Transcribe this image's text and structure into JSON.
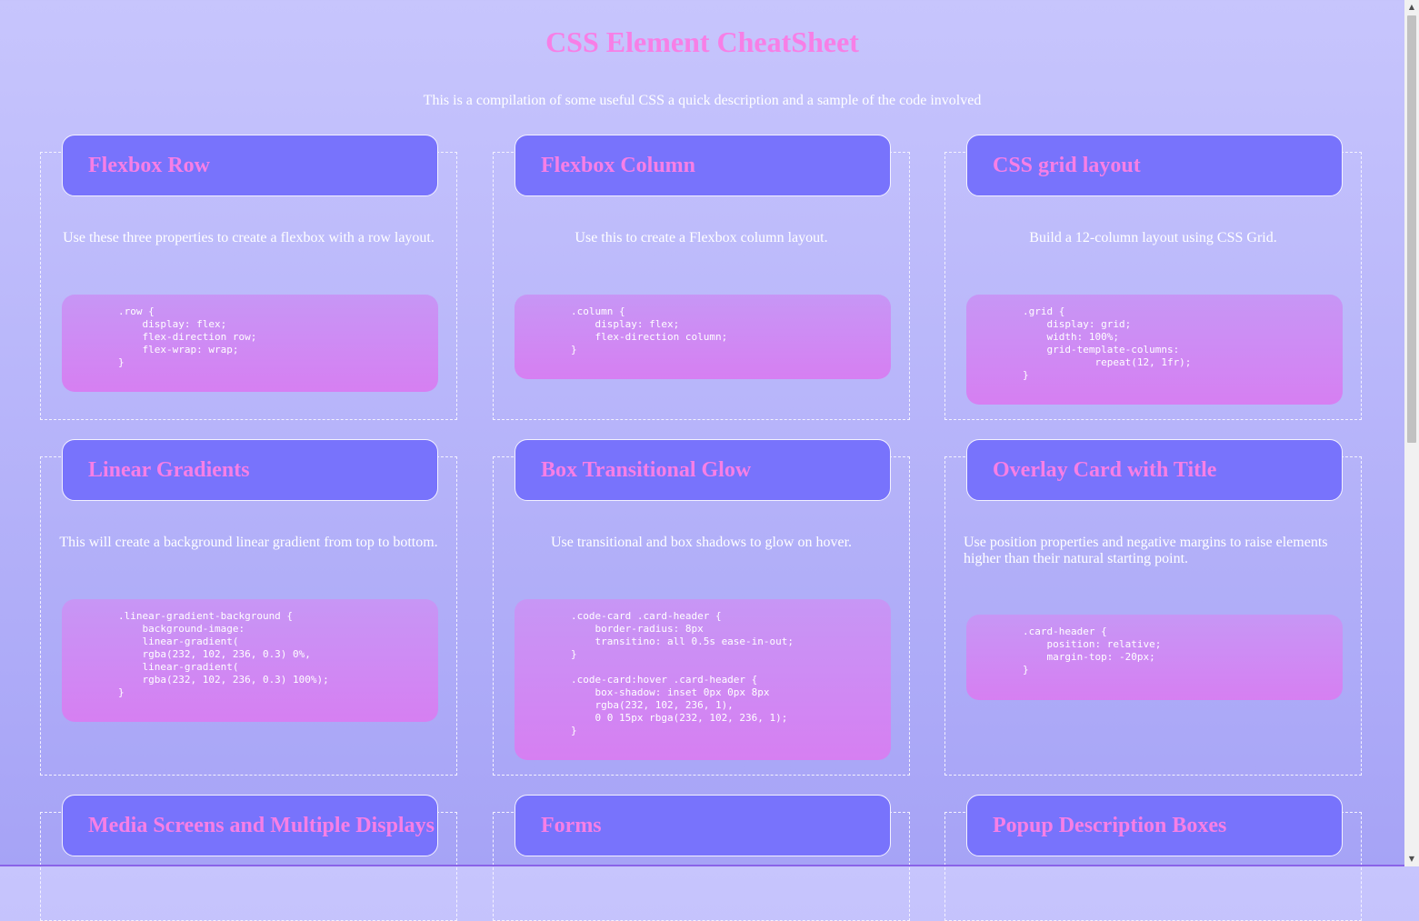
{
  "page": {
    "title": "CSS Element CheatSheet",
    "subtitle": "This is a compilation of some useful CSS a quick description and a sample of the code involved"
  },
  "cards": [
    {
      "title": "Flexbox Row",
      "description": "Use these three properties to create a flexbox with a row layout.",
      "code": ".row {\n    display: flex;\n    flex-direction row;\n    flex-wrap: wrap;\n}"
    },
    {
      "title": "Flexbox Column",
      "description": "Use this to create a Flexbox column layout.",
      "code": ".column {\n    display: flex;\n    flex-direction column;\n}"
    },
    {
      "title": "CSS grid layout",
      "description": "Build a 12-column layout using CSS Grid.",
      "code": ".grid {\n    display: grid;\n    width: 100%;\n    grid-template-columns:\n            repeat(12, 1fr);\n}"
    },
    {
      "title": "Linear Gradients",
      "description": "This will create a background linear gradient from top to bottom.",
      "code": ".linear-gradient-background {\n    background-image:\n    linear-gradient(\n    rgba(232, 102, 236, 0.3) 0%,\n    linear-gradient(\n    rgba(232, 102, 236, 0.3) 100%);\n}"
    },
    {
      "title": "Box Transitional Glow",
      "description": "Use transitional and box shadows to glow on hover.",
      "code": ".code-card .card-header {\n    border-radius: 8px\n    transitino: all 0.5s ease-in-out;\n}\n\n.code-card:hover .card-header {\n    box-shadow: inset 0px 0px 8px\n    rgba(232, 102, 236, 1),\n    0 0 15px rbga(232, 102, 236, 1);\n}"
    },
    {
      "title": "Overlay Card with Title",
      "description": "Use position properties and negative margins to raise elements higher than their natural starting point.",
      "code": ".card-header {\n    position: relative;\n    margin-top: -20px;\n}"
    },
    {
      "title": "Media Screens and Multiple Displays"
    },
    {
      "title": "Forms"
    },
    {
      "title": "Popup Description Boxes"
    }
  ],
  "colors": {
    "accent_pink": "#f77fe6",
    "header_purple": "#7873fc",
    "background_top": "#c7c5fd",
    "background_bottom": "#a6a3f6"
  },
  "scrollbar": {
    "up_icon": "triangle-up-icon",
    "down_icon": "triangle-down-icon"
  }
}
